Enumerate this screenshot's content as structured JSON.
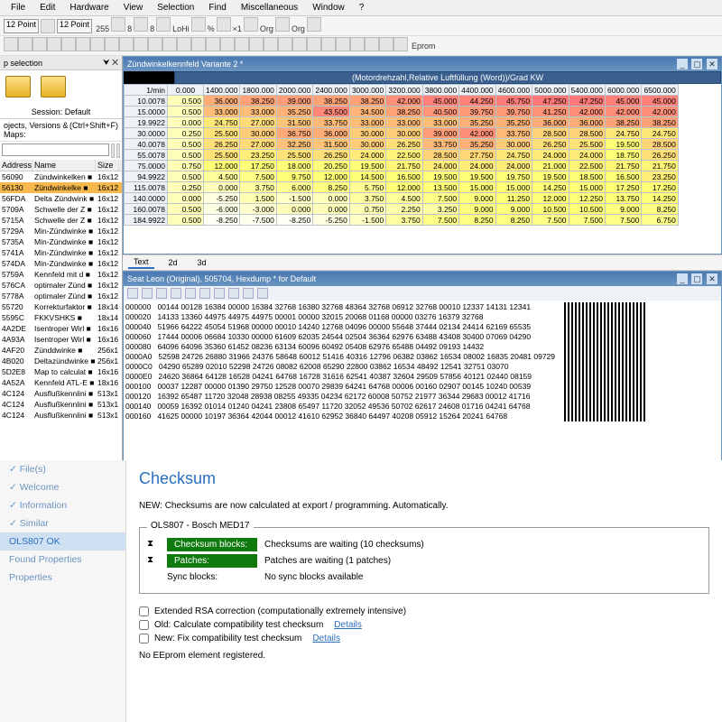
{
  "menus": [
    "File",
    "Edit",
    "Hardware",
    "View",
    "Selection",
    "Find",
    "Miscellaneous",
    "Window",
    "?"
  ],
  "toolbar1": {
    "fontA": "12 Point",
    "fontB": "12 Point",
    "labels": [
      "255",
      "8",
      "8",
      "LoHi",
      "%",
      "×1",
      "Org",
      "Org"
    ]
  },
  "toolbar2": {
    "eprom": "Eprom"
  },
  "sidebar": {
    "title": "p selection",
    "session": "Session: Default",
    "tabs_label": "ojects, Versions & Maps:",
    "shortcut": "(Ctrl+Shift+F)",
    "headers": [
      "Address",
      "Name",
      "Size"
    ],
    "rows": [
      {
        "a": "56090",
        "n": "Zündwinkelken",
        "s": "16x12"
      },
      {
        "a": "56130",
        "n": "Zündwinkelke",
        "s": "16x12",
        "sel": true
      },
      {
        "a": "56FDA",
        "n": "Delta Zündwink",
        "s": "16x12"
      },
      {
        "a": "5709A",
        "n": "Schwelle der Z",
        "s": "16x12"
      },
      {
        "a": "5715A",
        "n": "Schwelle der Z",
        "s": "16x12"
      },
      {
        "a": "5729A",
        "n": "Min-Zündwinke",
        "s": "16x12"
      },
      {
        "a": "5735A",
        "n": "Min-Zündwinke",
        "s": "16x12"
      },
      {
        "a": "5741A",
        "n": "Min-Zündwinke",
        "s": "16x12"
      },
      {
        "a": "574DA",
        "n": "Min-Zündwinke",
        "s": "16x12"
      },
      {
        "a": "5759A",
        "n": "Kennfeld mit d",
        "s": "16x12"
      },
      {
        "a": "576CA",
        "n": "optimaler Zünd",
        "s": "16x12"
      },
      {
        "a": "5778A",
        "n": "optimaler Zünd",
        "s": "16x12"
      },
      {
        "a": "55720",
        "n": "Korrekturfaktor",
        "s": "18x14"
      },
      {
        "a": "5595C",
        "n": "FKKVSHKS",
        "s": "18x14"
      },
      {
        "a": "4A2DE",
        "n": "Isentroper Wirl",
        "s": "16x16"
      },
      {
        "a": "4A93A",
        "n": "Isentroper Wirl",
        "s": "16x16"
      },
      {
        "a": "4AF20",
        "n": "Zünddwinke",
        "s": "256x1"
      },
      {
        "a": "4B020",
        "n": "Deltazündwinke",
        "s": "256x1"
      },
      {
        "a": "5D2E8",
        "n": "Map to calculat",
        "s": "16x16"
      },
      {
        "a": "4A52A",
        "n": "Kennfeld ATL-E",
        "s": "18x16"
      },
      {
        "a": "4C124",
        "n": "Ausflußkennlini",
        "s": "513x1"
      },
      {
        "a": "4C124",
        "n": "Ausflußkennlini",
        "s": "513x1"
      },
      {
        "a": "4C124",
        "n": "Ausflußkennlini",
        "s": "513x1"
      }
    ]
  },
  "kennfeld": {
    "title": "Zündwinkelkennfeld Variante 2 *",
    "axis_label": "(Motordrehzahl,Relative Luftfüllung (Word))/Grad KW",
    "unit": "1/min",
    "cols_top": [
      "00.000",
      "1800.000",
      "2400.000",
      "3200.000",
      "4400.000",
      "5000.000",
      "6000.000"
    ],
    "cols_bot": [
      "1400.000",
      "2000.000",
      "3000.000",
      "3800.000",
      "4600.000",
      "5400.000",
      "6500.000"
    ],
    "rows": [
      "10.0078",
      "15.0000",
      "19.9922",
      "30.0000",
      "40.0078",
      "55.0078",
      "75.0000",
      "94.9922",
      "115.0078",
      "140.0000",
      "160.0078",
      "184.9922"
    ],
    "chart_data": {
      "type": "heatmap",
      "xlabel": "1/min",
      "ylabel": "Relative Luftfüllung",
      "x": [
        0,
        1400,
        1800,
        2000,
        2400,
        3000,
        3200,
        3800,
        4400,
        4600,
        5000,
        5400,
        6000,
        6500
      ],
      "y": [
        10.0078,
        15.0,
        19.9922,
        30.0,
        40.0078,
        55.0078,
        75.0,
        94.9922,
        115.0078,
        140.0,
        160.0078,
        184.9922
      ],
      "values": [
        [
          0.5,
          36.0,
          38.25,
          39.0,
          38.25,
          38.25,
          42.0,
          45.0,
          44.25,
          45.75,
          47.25,
          47.25,
          45.0,
          45.0
        ],
        [
          0.5,
          33.0,
          33.0,
          35.25,
          43.5,
          34.5,
          38.25,
          40.5,
          39.75,
          39.75,
          41.25,
          42.0,
          42.0,
          42.0
        ],
        [
          0.0,
          24.75,
          27.0,
          31.5,
          33.75,
          33.0,
          33.0,
          33.0,
          35.25,
          35.25,
          36.0,
          36.0,
          38.25,
          38.25
        ],
        [
          0.25,
          25.5,
          30.0,
          36.75,
          36.0,
          30.0,
          30.0,
          39.0,
          42.0,
          33.75,
          28.5,
          28.5,
          24.75,
          24.75
        ],
        [
          0.5,
          26.25,
          27.0,
          32.25,
          31.5,
          30.0,
          26.25,
          33.75,
          35.25,
          30.0,
          26.25,
          25.5,
          19.5,
          28.5
        ],
        [
          0.5,
          25.5,
          23.25,
          25.5,
          26.25,
          24.0,
          22.5,
          28.5,
          27.75,
          24.75,
          24.0,
          24.0,
          18.75,
          26.25
        ],
        [
          0.75,
          12.0,
          17.25,
          18.0,
          20.25,
          19.5,
          21.75,
          24.0,
          24.0,
          24.0,
          21.0,
          22.5,
          21.75,
          21.75
        ],
        [
          0.5,
          4.5,
          7.5,
          9.75,
          12.0,
          14.5,
          16.5,
          19.5,
          19.5,
          19.75,
          19.5,
          18.5,
          16.5,
          23.25
        ],
        [
          0.25,
          0.0,
          3.75,
          6.0,
          8.25,
          5.75,
          12.0,
          13.5,
          15.0,
          15.0,
          14.25,
          15.0,
          17.25,
          17.25
        ],
        [
          0.0,
          -5.25,
          1.5,
          -1.5,
          0.0,
          3.75,
          4.5,
          7.5,
          9.0,
          11.25,
          12.0,
          12.25,
          13.75,
          14.25
        ],
        [
          0.5,
          -6.0,
          -3.0,
          0.0,
          0.0,
          0.75,
          2.25,
          3.25,
          9.0,
          9.0,
          10.5,
          10.5,
          9.0,
          8.25
        ],
        [
          0.5,
          -8.25,
          -7.5,
          -8.25,
          -5.25,
          -1.5,
          3.75,
          7.5,
          8.25,
          8.25,
          7.5,
          7.5,
          7.5,
          6.75
        ]
      ]
    }
  },
  "view_tabs": [
    "Text",
    "2d",
    "3d"
  ],
  "hex": {
    "title": "Seat Leon (Original), 505704, Hexdump * for Default",
    "offsets": [
      "000000",
      "000020",
      "000040",
      "000060",
      "000080",
      "0000A0",
      "0000C0",
      "0000E0",
      "000100",
      "000120",
      "000140",
      "000160"
    ],
    "lines": [
      "00144 00128 16384 00000 16384 32768 16380 32768 48364 32768 06912 32768 00010 12337 14131 12341",
      "14133 13360 44975 44975 44975 00001 00000 32015 20068 01168 00000 03276 16379 32768",
      "51966 64222 45054 51968 00000 00010 14240 12768 04096 00000 55648 37444 02134 24414 62169 65535",
      "17444 00006 06684 10330 00000 61609 62035 24544 02504 36364 62976 63488 43408 30400 07069 04290",
      "64096 64096 35360 61452 08236 63134 60096 60492 05408 62976 65488 04492 09193 14432",
      "52598 24726 26880 31966 24376 58648 60012 51416 40316 12796 06382 03862 16534 08002 16835 20481 09729",
      "04290 65289 02010 52298 24726 08082 62008 65290 22800 03862 16534 48492 12541 32751 03070",
      "24620 36864 64128 16528 04241 64768 16728 31616 62541 40387 32604 29509 57856 40121 02440 08159",
      "00037 12287 00000 01390 29750 12528 00070 29839 64241 64768 00006 00160 02907 00145 10240 00539",
      "16392 65487 11720 32048 28938 08255 49335 04234 62172 60008 50752 21977 36344 29683 00012 41716",
      "00059 16392 01014 01240 04241 23808 65497 11720 32052 49536 50702 62617 24608 01716 04241 64768",
      "41625 00000 10197 36364 42044 00012 41610 62952 36840 64497 40208 05912 15264 20241 64768"
    ]
  },
  "checksum": {
    "side_items": [
      "File(s)",
      "Welcome",
      "Information",
      "Similar",
      "OLS807 OK",
      "Found Properties",
      "Properties"
    ],
    "active_index": 4,
    "title": "Checksum",
    "note": "NEW: Checksums are now calculated at export / programming. Automatically.",
    "box_title": "OLS807 - Bosch MED17",
    "rows": [
      {
        "btn": "Checksum blocks:",
        "txt": "Checksums are waiting (10 checksums)"
      },
      {
        "btn": "Patches:",
        "txt": "Patches are waiting (1 patches)"
      },
      {
        "plain": "Sync blocks:",
        "txt": "No sync blocks available"
      }
    ],
    "checks": [
      "Extended RSA correction (computationally extremely intensive)",
      "Old: Calculate compatibility test checksum",
      "New: Fix compatibility test checksum"
    ],
    "details": "Details",
    "footer": "No EEprom element registered."
  }
}
